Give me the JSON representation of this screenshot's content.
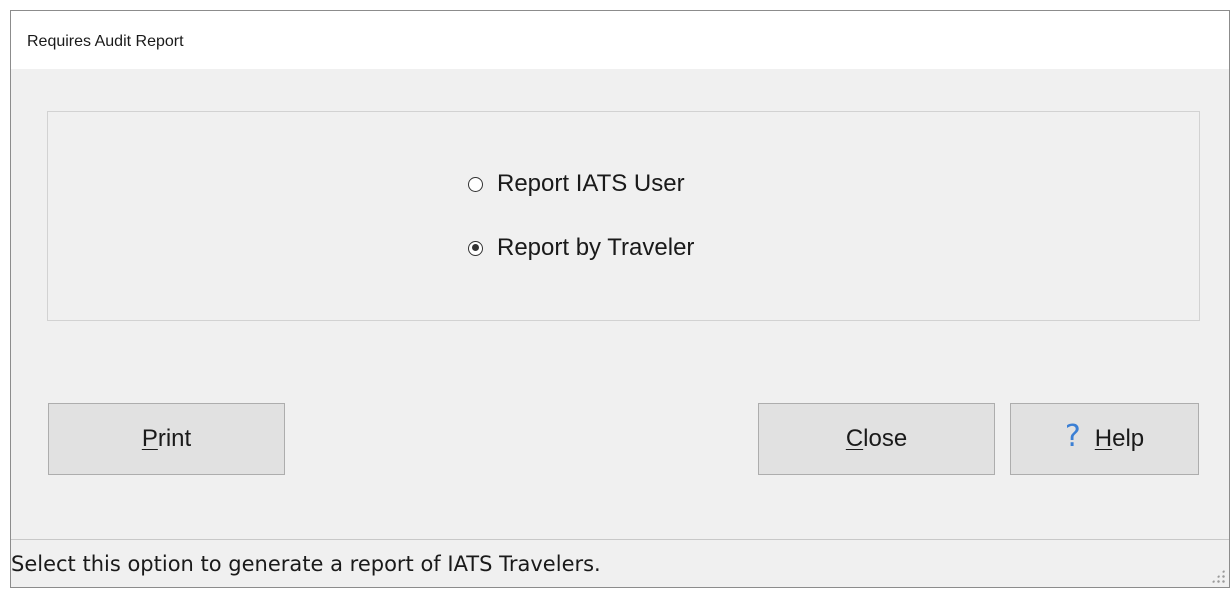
{
  "window": {
    "title": "Requires Audit Report"
  },
  "report_options": {
    "items": [
      {
        "label": "Report IATS User",
        "selected": false
      },
      {
        "label": "Report by Traveler",
        "selected": true
      }
    ]
  },
  "buttons": {
    "print": {
      "mnemonic": "P",
      "rest": "rint"
    },
    "close": {
      "mnemonic": "C",
      "rest": "lose"
    },
    "help": {
      "icon": "question-mark-icon",
      "mnemonic": "H",
      "rest": "elp"
    }
  },
  "status_bar": {
    "text": "Select this option to generate a report of IATS Travelers."
  },
  "colors": {
    "window_bg": "#f0f0f0",
    "titlebar_bg": "#ffffff",
    "button_bg": "#e1e1e1",
    "button_border": "#adadad",
    "help_icon": "#3b7fd4"
  }
}
